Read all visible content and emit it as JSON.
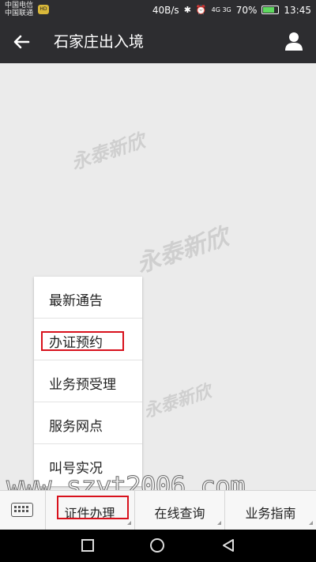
{
  "status_bar": {
    "carrier_line1": "中国电信",
    "carrier_line2": "中国联通",
    "badge": "HD",
    "net_speed": "40B/s",
    "signal_tags": "4G 3G",
    "battery_percent": "70%",
    "battery_level": 0.7,
    "time": "13:45"
  },
  "app_bar": {
    "title": "石家庄出入境"
  },
  "watermarks": [
    "永泰新欣",
    "永泰新欣",
    "永泰新欣"
  ],
  "popup_menu": {
    "items": [
      "最新通告",
      "办证预约",
      "业务预受理",
      "服务网点",
      "叫号实况"
    ],
    "highlighted_index": 1
  },
  "site_watermark": "www.szyt2006.com",
  "tab_bar": {
    "tabs": [
      "证件办理",
      "在线查询",
      "业务指南"
    ]
  },
  "colors": {
    "bar_bg": "#2d2d30",
    "highlight": "#d8111c",
    "page_bg": "#ebebeb"
  }
}
